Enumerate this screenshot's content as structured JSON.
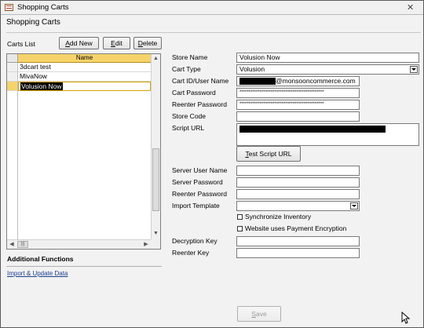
{
  "window": {
    "title": "Shopping Carts",
    "close_glyph": "✕"
  },
  "form_title": "Shopping Carts",
  "carts_list": {
    "label": "Carts List",
    "buttons": {
      "add_new": "Add New",
      "edit": "Edit",
      "delete": "Delete"
    },
    "column_header": "Name",
    "rows": [
      "3dcart test",
      "MivaNow",
      "Volusion Now"
    ],
    "selected_row": "Volusion Now"
  },
  "additional": {
    "heading": "Additional Functions",
    "link": "Import & Update Data"
  },
  "fields": {
    "store_name": {
      "label": "Store Name",
      "value": "Volusion Now"
    },
    "cart_type": {
      "label": "Cart Type",
      "value": "Volusion"
    },
    "cart_user": {
      "label": "Cart ID/User Name",
      "value_suffix": "@monsooncommerce.com"
    },
    "cart_password": {
      "label": "Cart Password",
      "value": "**********************************************"
    },
    "reenter_password": {
      "label": "Reenter Password",
      "value": "**********************************************"
    },
    "store_code": {
      "label": "Store Code",
      "value": ""
    },
    "script_url": {
      "label": "Script URL"
    },
    "test_script_url_button": "Test Script URL",
    "server_user_name": {
      "label": "Server User Name",
      "value": ""
    },
    "server_password": {
      "label": "Server Password",
      "value": ""
    },
    "server_reenter_password": {
      "label": "Reenter Password",
      "value": ""
    },
    "import_template": {
      "label": "Import Template",
      "value": ""
    },
    "synchronize_inventory": {
      "label": "Synchronize Inventory",
      "checked": false
    },
    "payment_encryption": {
      "label": "Website uses Payment Encryption",
      "checked": false
    },
    "decryption_key": {
      "label": "Decryption Key",
      "value": ""
    },
    "reenter_key": {
      "label": "Reenter Key",
      "value": ""
    }
  },
  "save_button": "Save",
  "scroll_glyphs": {
    "up": "▲",
    "down": "▼",
    "left": "◀",
    "right": "▶",
    "grip": "|||"
  }
}
